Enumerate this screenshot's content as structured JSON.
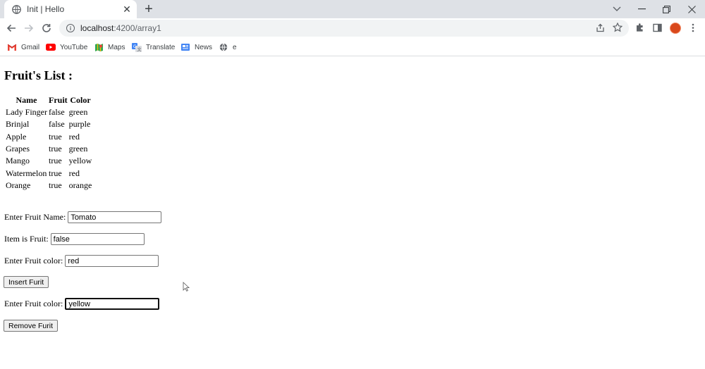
{
  "browser": {
    "tab": {
      "title": "Init | Hello",
      "favicon": "globe-icon"
    },
    "url": {
      "host": "localhost",
      "path": ":4200/array1"
    },
    "bookmarks": [
      {
        "label": "Gmail",
        "icon": "gmail-icon"
      },
      {
        "label": "YouTube",
        "icon": "youtube-icon"
      },
      {
        "label": "Maps",
        "icon": "maps-icon"
      },
      {
        "label": "Translate",
        "icon": "translate-icon"
      },
      {
        "label": "News",
        "icon": "news-icon"
      },
      {
        "label": "e",
        "icon": "globe-icon"
      }
    ],
    "profile_color": "#d9481c"
  },
  "page": {
    "title": "Fruit's List :",
    "table": {
      "headers": [
        "Name",
        "Fruit",
        "Color"
      ],
      "rows": [
        [
          "Lady Finger",
          "false",
          "green"
        ],
        [
          "Brinjal",
          "false",
          "purple"
        ],
        [
          "Apple",
          "true",
          "red"
        ],
        [
          "Grapes",
          "true",
          "green"
        ],
        [
          "Mango",
          "true",
          "yellow"
        ],
        [
          "Watermelon",
          "true",
          "red"
        ],
        [
          "Orange",
          "true",
          "orange"
        ]
      ]
    },
    "form": {
      "fruit_name_label": "Enter Fruit Name:",
      "fruit_name_value": "Tomato",
      "is_fruit_label": "Item is Fruit:",
      "is_fruit_value": "false",
      "color_label": "Enter Fruit color:",
      "color_value": "red",
      "insert_button": "Insert Furit",
      "remove_color_label": "Enter Fruit color:",
      "remove_color_value": "yellow",
      "remove_button": "Remove Furit"
    }
  }
}
